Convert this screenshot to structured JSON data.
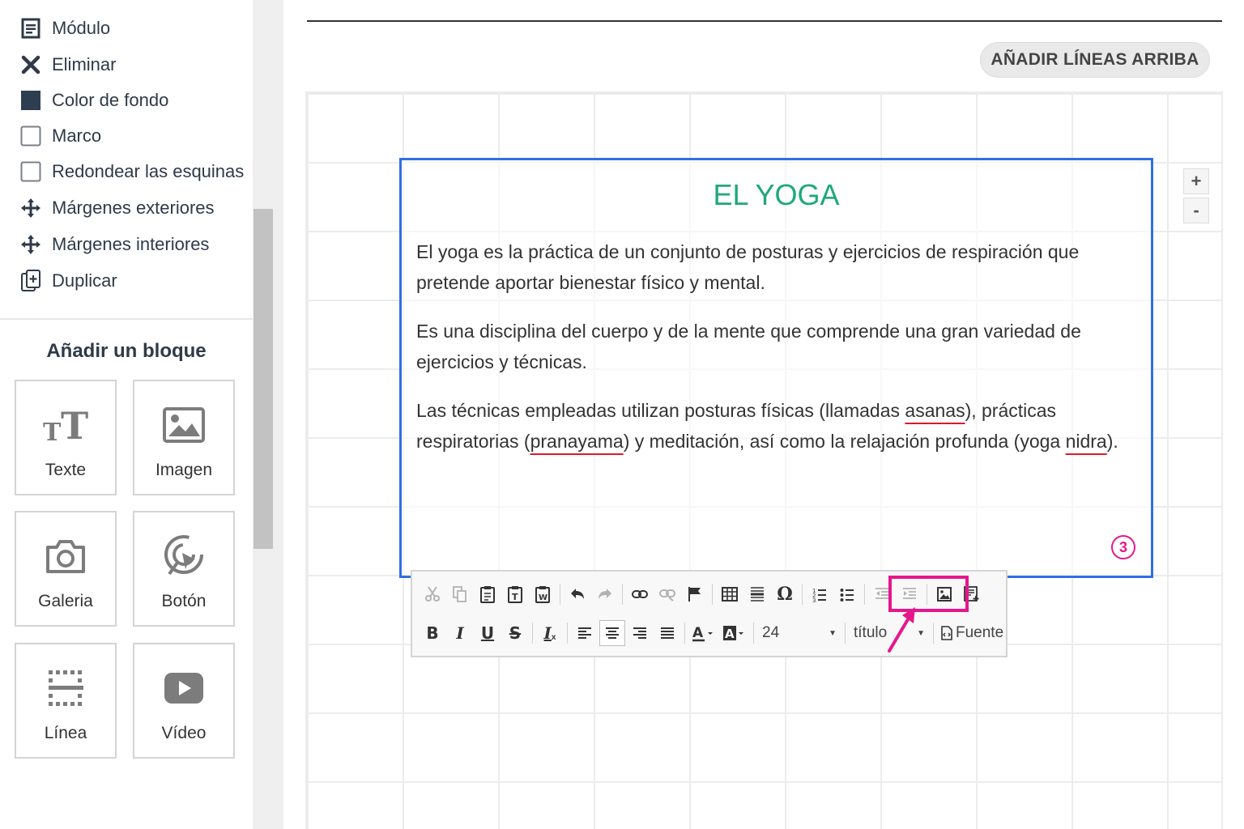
{
  "sidebar": {
    "menu": [
      {
        "label": "Módulo",
        "icon": "module-icon"
      },
      {
        "label": "Eliminar",
        "icon": "close-icon"
      },
      {
        "label": "Color de fondo",
        "icon": "color-swatch-icon"
      },
      {
        "label": "Marco",
        "icon": "checkbox-icon"
      },
      {
        "label": "Redondear las esquinas",
        "icon": "checkbox-icon"
      },
      {
        "label": "Márgenes exteriores",
        "icon": "move-arrows-icon"
      },
      {
        "label": "Márgenes interiores",
        "icon": "move-arrows-icon"
      },
      {
        "label": "Duplicar",
        "icon": "duplicate-icon"
      }
    ],
    "add_block_title": "Añadir un bloque",
    "blocks": [
      {
        "label": "Texte",
        "icon": "text-icon"
      },
      {
        "label": "Imagen",
        "icon": "image-icon"
      },
      {
        "label": "Galeria",
        "icon": "camera-icon"
      },
      {
        "label": "Botón",
        "icon": "cursor-click-icon"
      },
      {
        "label": "Línea",
        "icon": "dotted-line-icon"
      },
      {
        "label": "Vídeo",
        "icon": "youtube-icon"
      }
    ]
  },
  "main": {
    "add_lines_button": "AÑADIR LÍNEAS ARRIBA",
    "zoom_in": "+",
    "zoom_out": "-",
    "block": {
      "title": "EL YOGA",
      "paragraphs": [
        "El yoga es la práctica de un conjunto de posturas y ejercicios de respiración que pretende aportar bienestar físico y mental.",
        "Es una disciplina del cuerpo y de la mente que comprende una gran variedad de ejercicios y técnicas.",
        "Las técnicas empleadas utilizan posturas físicas (llamadas asanas), prácticas respiratorias (pranayama) y meditación, así como la relajación profunda (yoga nidra)."
      ],
      "p3_parts": {
        "a": "Las técnicas empleadas utilizan posturas físicas (llamadas ",
        "asanas": "asanas",
        "b": "), prácticas respiratorias (",
        "pranayama": "pranayama",
        "c": ") y meditación, así como la relajación profunda (yoga ",
        "nidra": "nidra",
        "d": ")."
      },
      "step_badge": "3",
      "title_color": "#1fa97a",
      "border_color": "#2f6fe4"
    }
  },
  "toolbar": {
    "row1": [
      "cut-icon",
      "copy-icon",
      "paste-icon",
      "paste-text-icon",
      "paste-word-icon",
      "undo-icon",
      "redo-icon",
      "link-icon",
      "unlink-icon",
      "anchor-flag-icon",
      "table-icon",
      "horizontal-rule-icon",
      "special-char-omega-icon",
      "numbered-list-icon",
      "bulleted-list-icon",
      "outdent-icon",
      "indent-icon",
      "insert-image-icon",
      "insert-template-icon"
    ],
    "bold": "B",
    "italic": "I",
    "underline": "U",
    "strike": "S",
    "clear_format": "I",
    "font_size": "24",
    "format": "título",
    "source_label": "Fuente",
    "highlight_color": "#e6168c"
  }
}
